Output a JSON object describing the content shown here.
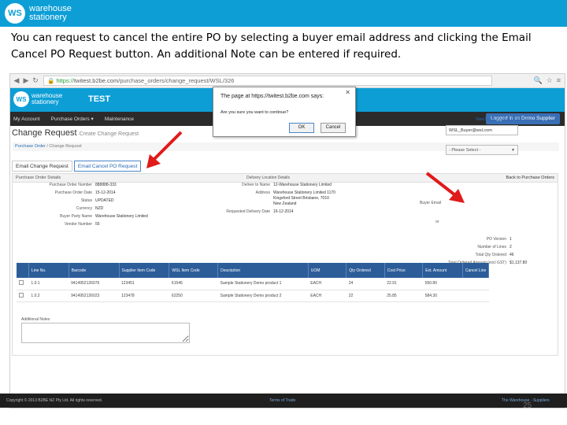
{
  "slide": {
    "logo_line1": "warehouse",
    "logo_line2": "stationery",
    "logo_badge": "WS",
    "instruction": "You can request to cancel the entire PO by selecting a buyer email address and clicking the Email Cancel PO Request button.  An additional Note can be entered if required.",
    "page_number": "25"
  },
  "browser": {
    "url_https": "https://",
    "url_host": "twitest.b2be.com",
    "url_path": "/purchase_orders/change_request/WSL/326"
  },
  "app": {
    "logo_badge": "WS",
    "logo_line1": "warehouse",
    "logo_line2": "stationery",
    "env_label": "TEST",
    "nav": [
      "My Account",
      "Purchase Orders ▾",
      "Maintenance"
    ],
    "logged_in": "Logged in as Demo Supplier"
  },
  "page": {
    "title": "Change Request",
    "subtitle": "Create Change Request",
    "breadcrumb_1": "Purchase Order",
    "breadcrumb_2": "Change Request",
    "tab_email_change": "Email Change Request",
    "tab_email_cancel": "Email Cancel PO Request",
    "panel_title": "Purchase Order Details",
    "back_link": "Back to Purchase Orders"
  },
  "po": {
    "left": [
      {
        "label": "Purchase Order Number",
        "value": "888888-333"
      },
      {
        "label": "Purchase Order Date",
        "value": "15-12-2014"
      },
      {
        "label": "Status",
        "value": "UPDATED"
      },
      {
        "label": "Currency",
        "value": "NZD"
      },
      {
        "label": "Buyer Party Name",
        "value": "Warehouse Stationery Limited"
      },
      {
        "label": "Vendor Number",
        "value": "55"
      }
    ],
    "delivery_heading": "Delivery Location Details",
    "delivery": [
      {
        "label": "Deliver to Name",
        "value": "12-Warehouse Stationery Limited"
      },
      {
        "label": "Address",
        "value": "Warehouse Stationery Limited 1170"
      },
      {
        "label": "",
        "value": "Kingsford Street Brisbane, 7010"
      },
      {
        "label": "",
        "value": "New Zealand"
      },
      {
        "label": "Requested Delivery Date",
        "value": "16-12-2014"
      }
    ],
    "view_contact": "View Buyer Contact Detail List",
    "buyer_email_label": "Buyer Email",
    "buyer_email_value": "WSL_Buyer@wsl.com",
    "or_label": "or",
    "please_select": "- Please Select -",
    "summary": [
      {
        "label": "PO Version",
        "value": "1"
      },
      {
        "label": "Number of Lines",
        "value": "2"
      },
      {
        "label": "Total Qty Ordered",
        "value": "46"
      },
      {
        "label": "Total Ordered Amount (excl GST)",
        "value": "$1,137.80"
      }
    ]
  },
  "lines": {
    "headers": [
      "",
      "Line No.",
      "Barcode",
      "Supplier Item Code",
      "WSL Item Code",
      "Description",
      "UOM",
      "Qty Ordered",
      "Cost Price",
      "Ext. Amount",
      "Cancel Line"
    ],
    "rows": [
      [
        "",
        "1.0.1",
        "9414952126076",
        "123451",
        "61546",
        "Sample Stationery Demo product 1",
        "EACH",
        "24",
        "22.91",
        "550.80"
      ],
      [
        "",
        "1.0.2",
        "9414952126023",
        "123478",
        "62250",
        "Sample Stationery Demo product 2",
        "EACH",
        "22",
        "25.85",
        "584.30"
      ]
    ]
  },
  "notes_label": "Additional Notes",
  "dialog": {
    "title": "The page at https://twitest.b2be.com says:",
    "message": "Are you sure you want to continue?",
    "ok": "OK",
    "cancel": "Cancel"
  },
  "footer": {
    "copyright": "Copyright © 2013 B2BE NZ Pty Ltd. All rights reserved.",
    "terms": "Terms of Trade",
    "supplier_link": "The Warehouse - Suppliers"
  },
  "colors": {
    "brand": "#0d9ed6",
    "table_header": "#2c5d99",
    "arrow": "#e11a1a"
  }
}
